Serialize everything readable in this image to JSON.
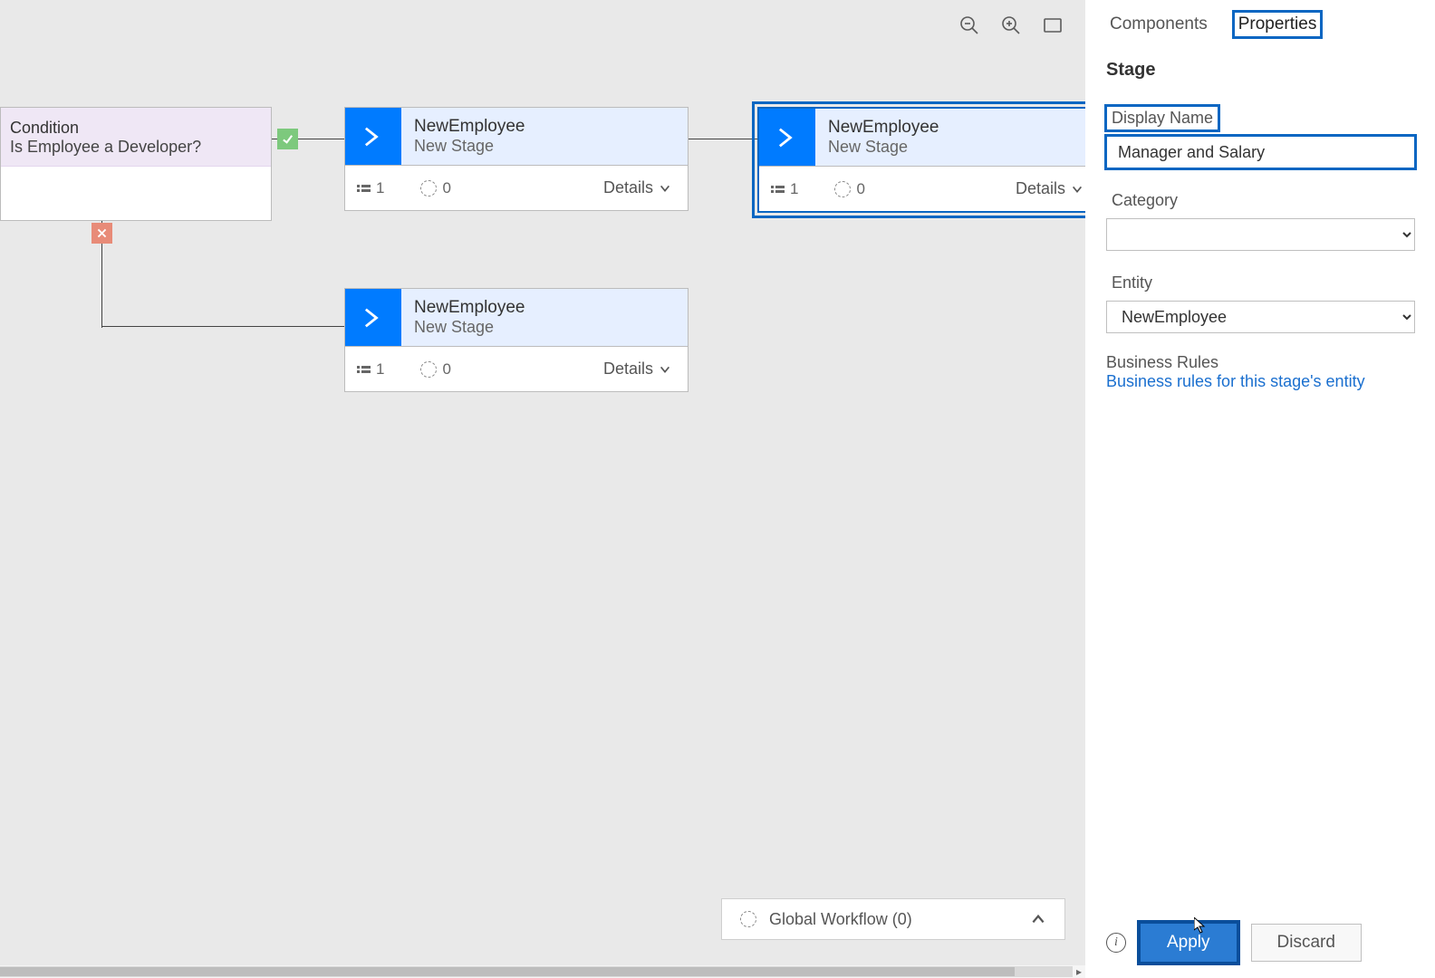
{
  "canvas": {
    "condition": {
      "type_label": "Condition",
      "name": "Is Employee a Developer?"
    },
    "stages": [
      {
        "entity": "NewEmployee",
        "name": "New Stage",
        "steps_count": "1",
        "triggers_count": "0",
        "details_label": "Details",
        "selected": false
      },
      {
        "entity": "NewEmployee",
        "name": "New Stage",
        "steps_count": "1",
        "triggers_count": "0",
        "details_label": "Details",
        "selected": true
      },
      {
        "entity": "NewEmployee",
        "name": "New Stage",
        "steps_count": "1",
        "triggers_count": "0",
        "details_label": "Details",
        "selected": false
      }
    ],
    "global_workflow_label": "Global Workflow (0)"
  },
  "panel": {
    "tabs": {
      "components": "Components",
      "properties": "Properties",
      "active": "properties"
    },
    "title": "Stage",
    "display_name_label": "Display Name",
    "display_name_value": "Manager and Salary",
    "category_label": "Category",
    "category_value": "",
    "entity_label": "Entity",
    "entity_value": "NewEmployee",
    "br_label": "Business Rules",
    "br_link": "Business rules for this stage's entity",
    "apply_label": "Apply",
    "discard_label": "Discard"
  }
}
